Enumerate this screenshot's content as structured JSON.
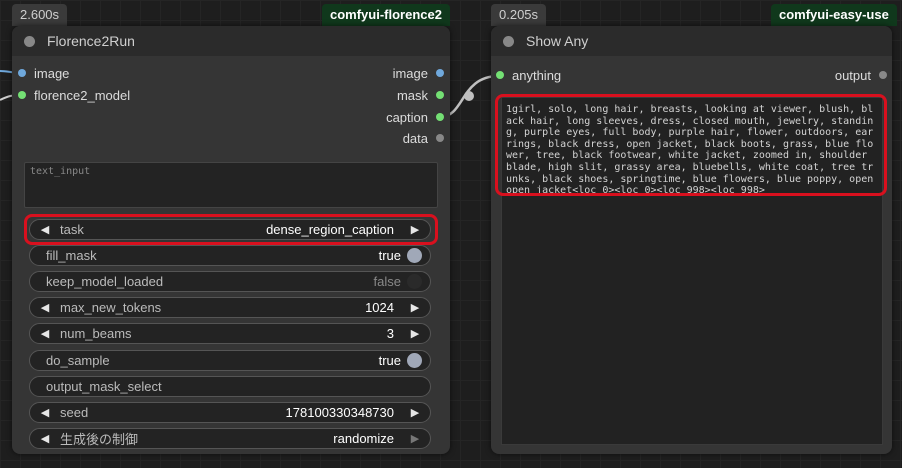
{
  "florence_node": {
    "timing": "2.600s",
    "pack": "comfyui-florence2",
    "title": "Florence2Run",
    "inputs": [
      {
        "label": "image",
        "color": "#6fa8dc"
      },
      {
        "label": "florence2_model",
        "color": "#74e074"
      }
    ],
    "outputs": [
      {
        "label": "image",
        "color": "#6fa8dc"
      },
      {
        "label": "mask",
        "color": "#74e074"
      },
      {
        "label": "caption",
        "color": "#74e074"
      },
      {
        "label": "data",
        "color": "#888888"
      }
    ],
    "text_input_placeholder": "text_input",
    "widgets": {
      "task": {
        "label": "task",
        "value": "dense_region_caption"
      },
      "fill_mask": {
        "label": "fill_mask",
        "value": "true"
      },
      "keep_model_loaded": {
        "label": "keep_model_loaded",
        "value": "false"
      },
      "max_new_tokens": {
        "label": "max_new_tokens",
        "value": "1024"
      },
      "num_beams": {
        "label": "num_beams",
        "value": "3"
      },
      "do_sample": {
        "label": "do_sample",
        "value": "true"
      },
      "output_mask_select": {
        "label": "output_mask_select",
        "value": ""
      },
      "seed": {
        "label": "seed",
        "value": "178100330348730"
      },
      "control_after_generate": {
        "label": "生成後の制御",
        "value": "randomize"
      }
    }
  },
  "show_node": {
    "timing": "0.205s",
    "pack": "comfyui-easy-use",
    "title": "Show Any",
    "input": {
      "label": "anything",
      "color": "#74e074"
    },
    "output": {
      "label": "output",
      "color": "#888888"
    },
    "text": "1girl, solo, long hair, breasts, looking at viewer, blush, black hair, long sleeves, dress, closed mouth, jewelry, standing, purple eyes, full body, purple hair, flower, outdoors, earrings, black dress, open jacket, black boots, grass, blue flower, tree, black footwear, white jacket, zoomed in, shoulder blade, high slit, grassy area, bluebells, white coat, tree trunks, black shoes, springtime, blue flowers, blue poppy, open open jacket<loc_0><loc_0><loc_998><loc_998>"
  },
  "icons": {
    "arrow_left": "◀",
    "arrow_right": "▶"
  },
  "colors": {
    "highlight": "#d9101e",
    "toggle_on": "#a0a8b8",
    "toggle_off": "#2a2a2a",
    "wire": "#bfbfbf"
  }
}
